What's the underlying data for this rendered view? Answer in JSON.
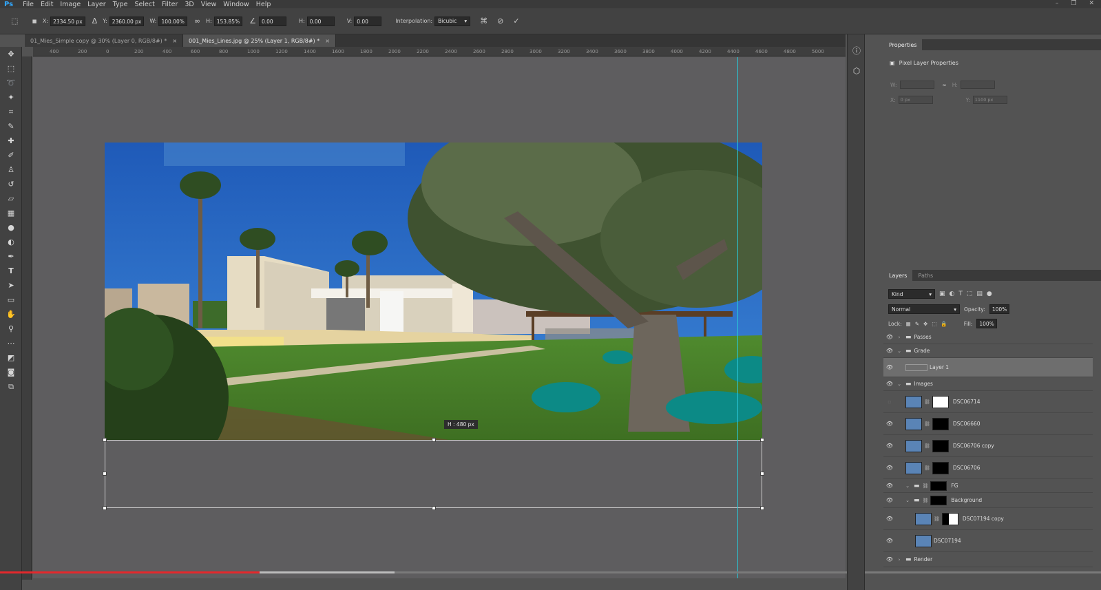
{
  "app": {
    "logo": "Ps",
    "menu": [
      "File",
      "Edit",
      "Image",
      "Layer",
      "Type",
      "Select",
      "Filter",
      "3D",
      "View",
      "Window",
      "Help"
    ]
  },
  "options": {
    "x_label": "X:",
    "x_value": "2334.50 px",
    "y_label": "Y:",
    "y_value": "2360.00 px",
    "w_label": "W:",
    "w_value": "100.00%",
    "h_label": "H:",
    "h_value": "153.85%",
    "angle_value": "0.00",
    "hskew_label": "H:",
    "hskew_value": "0.00",
    "vskew_label": "V:",
    "vskew_value": "0.00",
    "interp_label": "Interpolation:",
    "interp_value": "Bicubic"
  },
  "tabs": [
    {
      "label": "01_Mies_Simple copy @ 30% (Layer 0, RGB/8#) *",
      "active": false
    },
    {
      "label": "001_Mies_Lines.jpg @ 25% (Layer 1, RGB/8#) *",
      "active": true
    }
  ],
  "ruler_ticks": [
    "400",
    "200",
    "0",
    "200",
    "400",
    "600",
    "800",
    "1000",
    "1200",
    "1400",
    "1600",
    "1800",
    "2000",
    "2200",
    "2400",
    "2600",
    "2800",
    "3000",
    "3200",
    "3400",
    "3600",
    "3800",
    "4000",
    "4200",
    "4400",
    "4600",
    "4800",
    "5000"
  ],
  "canvas": {
    "hint": "H : 480 px",
    "progress_fraction": 0.236
  },
  "properties": {
    "tab": "Properties",
    "title": "Pixel Layer Properties",
    "w_label": "W:",
    "h_label": "H:",
    "x_label": "X:",
    "y_label": "Y:",
    "x_value": "0 px",
    "y_value": "1100 px"
  },
  "layers": {
    "tabs": [
      "Layers",
      "Paths"
    ],
    "filter_kind": "Kind",
    "blend_mode": "Normal",
    "opacity_label": "Opacity:",
    "opacity_value": "100%",
    "lock_label": "Lock:",
    "fill_label": "Fill:",
    "fill_value": "100%",
    "items": [
      {
        "name": "Passes",
        "type": "group"
      },
      {
        "name": "Grade",
        "type": "group"
      },
      {
        "name": "Layer 1",
        "type": "layer"
      },
      {
        "name": "Images",
        "type": "group"
      },
      {
        "name": "DSC06714",
        "type": "layer"
      },
      {
        "name": "DSC06660",
        "type": "layer"
      },
      {
        "name": "DSC06706 copy",
        "type": "layer"
      },
      {
        "name": "DSC06706",
        "type": "layer"
      },
      {
        "name": "FG",
        "type": "group"
      },
      {
        "name": "Background",
        "type": "group"
      },
      {
        "name": "DSC07194 copy",
        "type": "layer"
      },
      {
        "name": "DSC07194",
        "type": "layer"
      },
      {
        "name": "Render",
        "type": "group"
      }
    ]
  },
  "colors": {
    "accent_blue": "#31a8ff",
    "guide": "#29c6d6",
    "progress": "#e5282c"
  }
}
